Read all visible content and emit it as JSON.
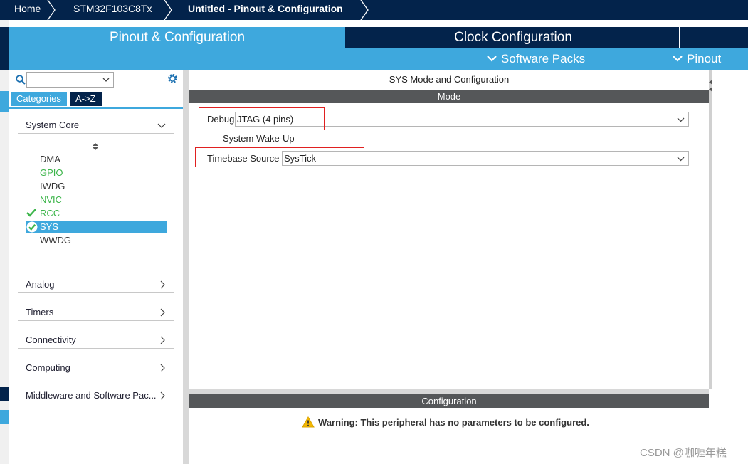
{
  "breadcrumb": {
    "items": [
      "Home",
      "STM32F103C8Tx",
      "Untitled - Pinout & Configuration"
    ]
  },
  "tabs": {
    "pinout": "Pinout & Configuration",
    "clock": "Clock Configuration"
  },
  "subnav": {
    "software_packs": "Software Packs",
    "pinout": "Pinout"
  },
  "leftpanel": {
    "search": {
      "value": ""
    },
    "category_tabs": {
      "categories": "Categories",
      "az": "A->Z"
    },
    "system_core": {
      "label": "System Core",
      "items": [
        {
          "label": "DMA",
          "state": "plain"
        },
        {
          "label": "GPIO",
          "state": "green"
        },
        {
          "label": "IWDG",
          "state": "plain"
        },
        {
          "label": "NVIC",
          "state": "green"
        },
        {
          "label": "RCC",
          "state": "checked"
        },
        {
          "label": "SYS",
          "state": "selected"
        },
        {
          "label": "WWDG",
          "state": "plain"
        }
      ]
    },
    "sections": [
      "Analog",
      "Timers",
      "Connectivity",
      "Computing",
      "Middleware and Software Pac..."
    ]
  },
  "main": {
    "title": "SYS Mode and Configuration",
    "mode_header": "Mode",
    "debug": {
      "label": "Debug",
      "value": "JTAG (4 pins)"
    },
    "wakeup": {
      "label": "System Wake-Up",
      "checked": false
    },
    "timebase": {
      "label": "Timebase Source",
      "value": "SysTick"
    },
    "config_header": "Configuration",
    "warning": "Warning: This peripheral has no parameters to be configured."
  },
  "watermark": "CSDN @咖喱年糕",
  "colors": {
    "navy": "#03234b",
    "accent": "#3ea8dd",
    "green": "#3cb54a",
    "highlight": "#e02020",
    "header_gray": "#555759"
  }
}
